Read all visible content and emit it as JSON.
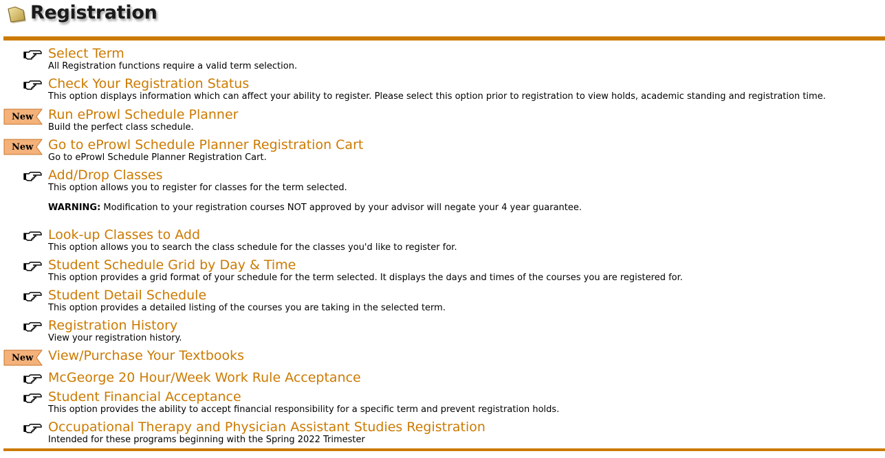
{
  "header": {
    "title": "Registration"
  },
  "items": [
    {
      "label": "Select Term",
      "desc": "All Registration functions require a valid term selection.",
      "badge": ""
    },
    {
      "label": "Check Your Registration Status",
      "desc": "This option displays information which can affect your ability to register. Please select this option prior to registration to view holds, academic standing and registration time.",
      "badge": ""
    },
    {
      "label": "Run eProwl Schedule Planner",
      "desc": "Build the perfect class schedule.",
      "badge": "New"
    },
    {
      "label": "Go to eProwl Schedule Planner Registration Cart",
      "desc": "Go to eProwl Schedule Planner Registration Cart.",
      "badge": "New"
    },
    {
      "label": "Add/Drop Classes",
      "desc": "This option allows you to register for classes for the term selected.",
      "badge": "",
      "warning_label": "WARNING:",
      "warning_text": " Modification to your registration courses NOT approved by your advisor will negate your 4 year guarantee."
    },
    {
      "label": "Look-up Classes to Add",
      "desc": "This option allows you to search the class schedule for the classes you'd like to register for.",
      "badge": ""
    },
    {
      "label": "Student Schedule Grid by Day & Time",
      "desc": "This option provides a grid format of your schedule for the term selected. It displays the days and times of the courses you are registered for.",
      "badge": ""
    },
    {
      "label": "Student Detail Schedule",
      "desc": "This option provides a detailed listing of the courses you are taking in the selected term.",
      "badge": ""
    },
    {
      "label": "Registration History",
      "desc": "View your registration history.",
      "badge": ""
    },
    {
      "label": "View/Purchase Your Textbooks",
      "desc": "",
      "badge": "New"
    },
    {
      "label": "McGeorge 20 Hour/Week Work Rule Acceptance",
      "desc": "",
      "badge": ""
    },
    {
      "label": "Student Financial Acceptance",
      "desc": "This option provides the ability to accept financial responsibility for a specific term and prevent registration holds.",
      "badge": ""
    },
    {
      "label": "Occupational Therapy and Physician Assistant Studies Registration",
      "desc": "Intended for these programs beginning with the Spring 2022 Trimester",
      "badge": ""
    }
  ],
  "colors": {
    "accent": "#cc7a00",
    "text": "#000000",
    "badge_fill": "#f4b27a"
  },
  "icons": {
    "title_icon": "folder-icon",
    "bullet_icon": "pointing-hand-icon",
    "new_icon": "new-ribbon-icon"
  }
}
